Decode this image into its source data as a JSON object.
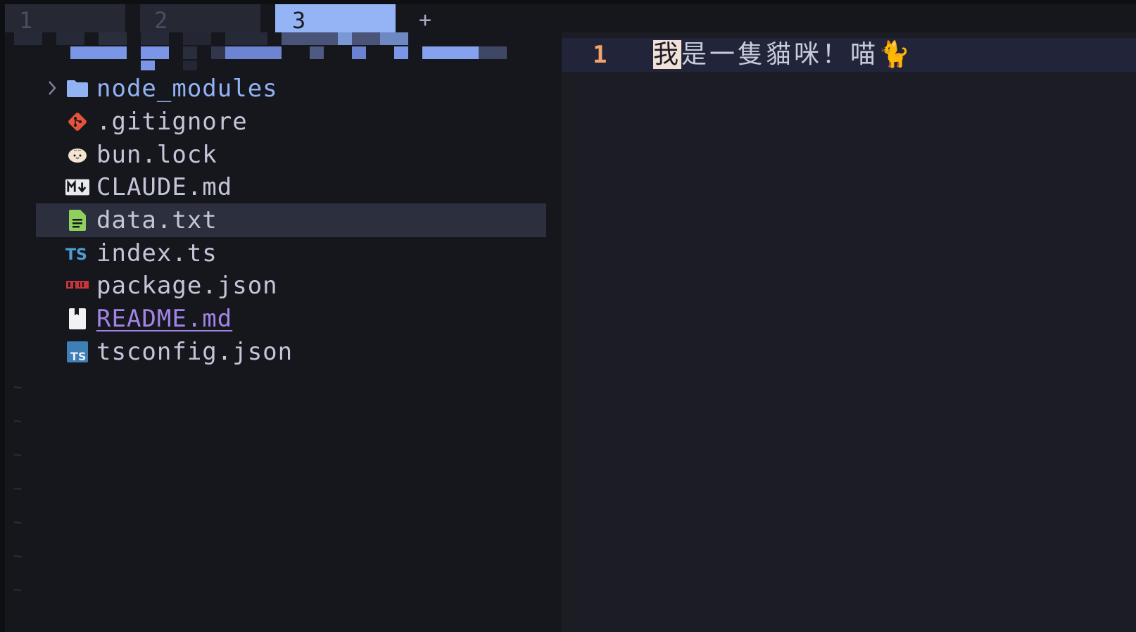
{
  "tabs": [
    {
      "label": "1",
      "active": false
    },
    {
      "label": "2",
      "active": false
    },
    {
      "label": "3",
      "active": true
    }
  ],
  "new_tab_label": "+",
  "explorer": {
    "items": [
      {
        "name": "node_modules",
        "kind": "folder",
        "icon": "folder-icon",
        "expandable": true
      },
      {
        "name": ".gitignore",
        "kind": "file",
        "icon": "git-icon"
      },
      {
        "name": "bun.lock",
        "kind": "file",
        "icon": "bun-icon"
      },
      {
        "name": "CLAUDE.md",
        "kind": "file",
        "icon": "markdown-icon"
      },
      {
        "name": "data.txt",
        "kind": "file",
        "icon": "text-file-icon",
        "selected": true
      },
      {
        "name": "index.ts",
        "kind": "file",
        "icon": "typescript-icon"
      },
      {
        "name": "package.json",
        "kind": "file",
        "icon": "npm-icon"
      },
      {
        "name": "README.md",
        "kind": "file",
        "icon": "readme-icon"
      },
      {
        "name": "tsconfig.json",
        "kind": "file",
        "icon": "tsconfig-icon"
      }
    ]
  },
  "editor": {
    "line_number": "1",
    "cursor_char": "我",
    "rest_text": "是一隻貓咪！喵🐈"
  },
  "colors": {
    "active_tab": "#94b4f6",
    "folder": "#93b2f5",
    "line_number": "#f0a36a",
    "selection": "#2c2f3e",
    "readme": "#a283e6"
  }
}
